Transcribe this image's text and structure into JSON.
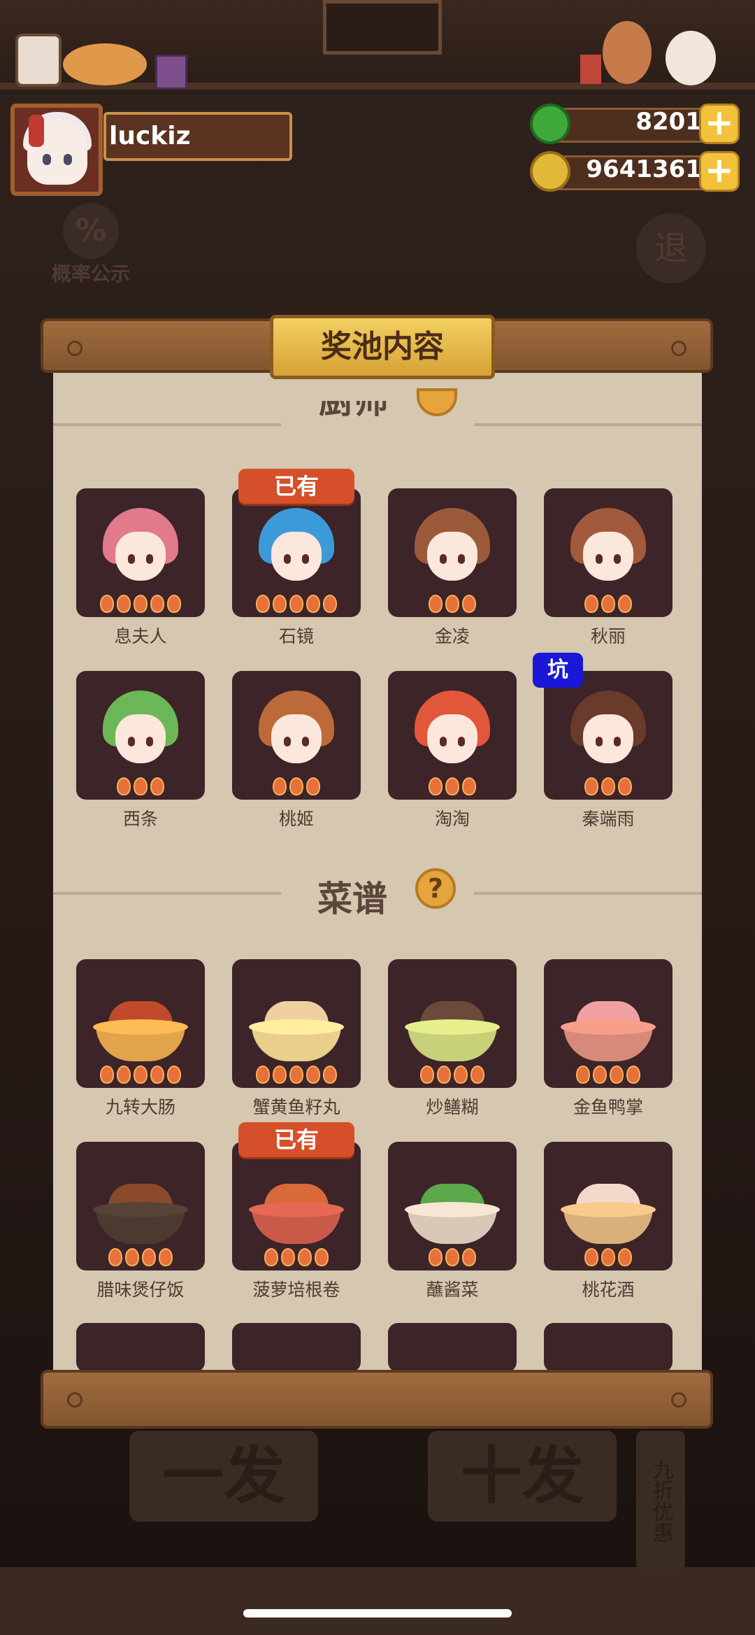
{
  "player": {
    "name": "luckiz"
  },
  "currencies": [
    {
      "icon": "jade-coin-icon",
      "value": "8201",
      "color": "#3fa83a"
    },
    {
      "icon": "gold-coin-icon",
      "value": "9641361",
      "color": "#e2b83a"
    }
  ],
  "background": {
    "prob_icon": "%",
    "prob_label": "概率公示",
    "exit_label": "退",
    "single_draw": "一发",
    "ten_draw": "十发",
    "discount": "九折优惠"
  },
  "panel": {
    "title": "奖池内容",
    "chef_section": "厨师",
    "recipe_section": "菜谱",
    "help_glyph": "?",
    "owned_badge": "已有",
    "pit_badge": "坑"
  },
  "chefs": [
    {
      "name": "息夫人",
      "stars": 5,
      "hair": "#e17a8a",
      "owned": false,
      "pit": false
    },
    {
      "name": "石镜",
      "stars": 5,
      "hair": "#3d9ad8",
      "owned": true,
      "pit": false
    },
    {
      "name": "金凌",
      "stars": 3,
      "hair": "#9a5a3a",
      "owned": false,
      "pit": false
    },
    {
      "name": "秋丽",
      "stars": 3,
      "hair": "#a25a3c",
      "owned": false,
      "pit": false
    },
    {
      "name": "西条",
      "stars": 3,
      "hair": "#6cb858",
      "owned": false,
      "pit": false
    },
    {
      "name": "桃姬",
      "stars": 3,
      "hair": "#bd6a3a",
      "owned": false,
      "pit": false
    },
    {
      "name": "淘淘",
      "stars": 3,
      "hair": "#e2563a",
      "owned": false,
      "pit": false
    },
    {
      "name": "秦端雨",
      "stars": 3,
      "hair": "#6a3a2a",
      "owned": false,
      "pit": true
    }
  ],
  "recipes": [
    {
      "name": "九转大肠",
      "stars": 5,
      "food": "#c04a2a",
      "plate": "#e2a34a",
      "owned": false
    },
    {
      "name": "蟹黄鱼籽丸",
      "stars": 5,
      "food": "#f0d0a0",
      "plate": "#e8cf8a",
      "owned": false
    },
    {
      "name": "炒鳝糊",
      "stars": 4,
      "food": "#6a4a3a",
      "plate": "#c9d07a",
      "owned": false
    },
    {
      "name": "金鱼鸭掌",
      "stars": 4,
      "food": "#f0a0a0",
      "plate": "#d88a7a",
      "owned": false
    },
    {
      "name": "腊味煲仔饭",
      "stars": 4,
      "food": "#8a4a2a",
      "plate": "#4a3a30",
      "owned": false
    },
    {
      "name": "菠萝培根卷",
      "stars": 4,
      "food": "#d86a3a",
      "plate": "#c95a4a",
      "owned": true
    },
    {
      "name": "蘸酱菜",
      "stars": 3,
      "food": "#5aa84a",
      "plate": "#d8c8b8",
      "owned": false
    },
    {
      "name": "桃花酒",
      "stars": 3,
      "food": "#f4d8cc",
      "plate": "#d8b07a",
      "owned": false
    }
  ]
}
